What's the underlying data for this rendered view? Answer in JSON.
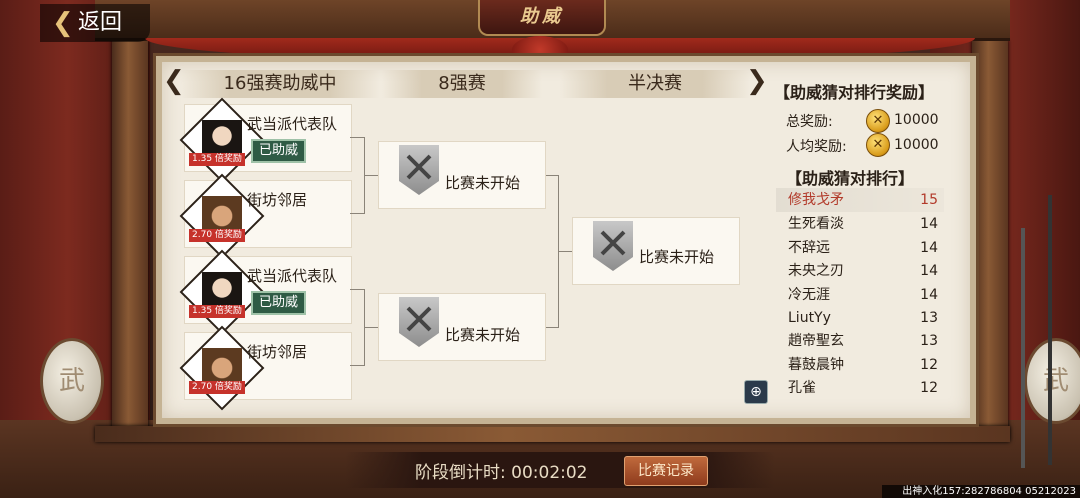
{
  "header": {
    "back_label": "返回",
    "title": "助威"
  },
  "rounds": {
    "r16": "16强赛助威中",
    "r8": "8强赛",
    "semi": "半决赛"
  },
  "bracket": {
    "teams": [
      {
        "name": "武当派代表队",
        "odds": "1.35 倍奖励",
        "badge": "已助威"
      },
      {
        "name": "街坊邻居",
        "odds": "2.70 倍奖励",
        "badge": ""
      },
      {
        "name": "武当派代表队",
        "odds": "1.35 倍奖励",
        "badge": "已助威"
      },
      {
        "name": "街坊邻居",
        "odds": "2.70 倍奖励",
        "badge": ""
      }
    ],
    "matches": [
      {
        "status": "比赛未开始"
      },
      {
        "status": "比赛未开始"
      },
      {
        "status": "比赛未开始"
      }
    ]
  },
  "rewards": {
    "title": "【助威猜对排行奖励】",
    "total_label": "总奖励:",
    "total_value": "10000",
    "avg_label": "人均奖励:",
    "avg_value": "10000"
  },
  "ranking": {
    "title": "【助威猜对排行】",
    "rows": [
      {
        "name": "修我戈矛",
        "score": "15"
      },
      {
        "name": "生死看淡",
        "score": "14"
      },
      {
        "name": "不辞远",
        "score": "14"
      },
      {
        "name": "未央之刃",
        "score": "14"
      },
      {
        "name": "冷无涯",
        "score": "14"
      },
      {
        "name": "LiutYy",
        "score": "13"
      },
      {
        "name": "趙帝聖玄",
        "score": "13"
      },
      {
        "name": "暮鼓晨钟",
        "score": "12"
      },
      {
        "name": "孔雀",
        "score": "12"
      }
    ]
  },
  "footer": {
    "countdown_label": "阶段倒计时:",
    "countdown_value": "00:02:02",
    "record_button": "比赛记录",
    "watermark": "出神入化157:282786804 05212023"
  },
  "decor": {
    "drum_text": "武"
  },
  "colors": {
    "highlight_rank": "#b23a2a",
    "odds_badge": "#c6322b",
    "supported_badge": "#2f5b45"
  }
}
